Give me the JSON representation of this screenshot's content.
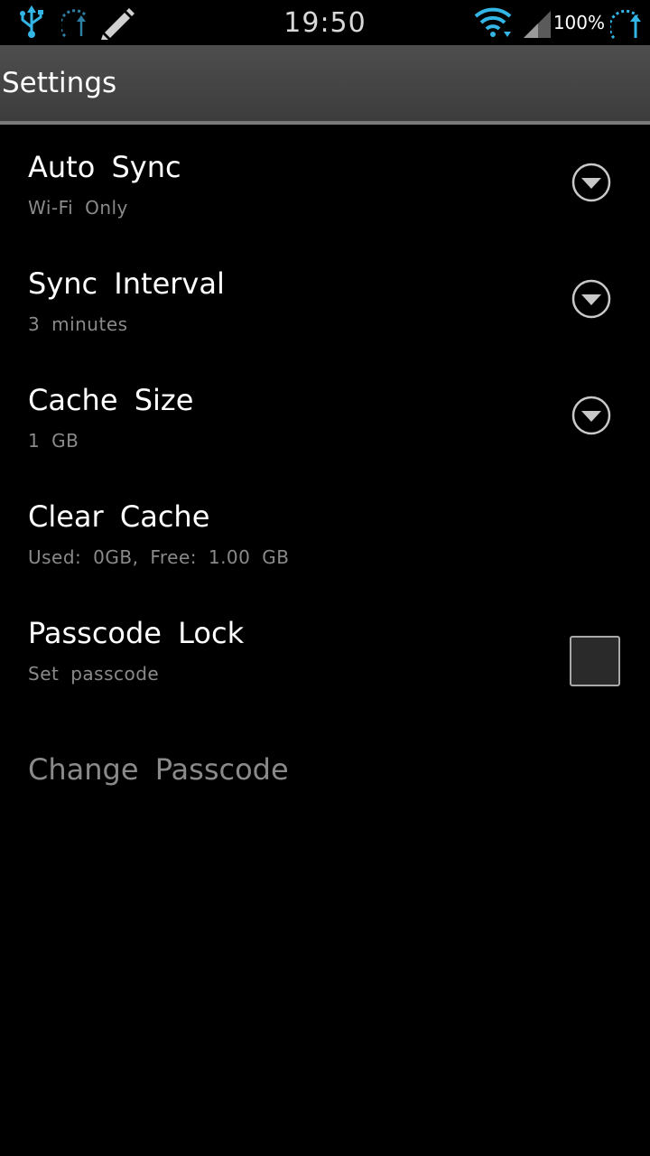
{
  "status_bar": {
    "time": "19:50",
    "battery": "100%",
    "icons": [
      "usb-icon",
      "sync-progress-icon",
      "edit-icon",
      "wifi-icon",
      "signal-icon",
      "battery-charging-icon"
    ],
    "accent": "#33b5e5"
  },
  "action_bar": {
    "title": "Settings"
  },
  "settings": [
    {
      "label": "Auto Sync",
      "summary": "Wi-Fi Only",
      "control": "dropdown"
    },
    {
      "label": "Sync Interval",
      "summary": "3 minutes",
      "control": "dropdown"
    },
    {
      "label": "Cache Size",
      "summary": "1 GB",
      "control": "dropdown"
    },
    {
      "label": "Clear Cache",
      "summary": "Used: 0GB, Free: 1.00 GB",
      "control": "none"
    },
    {
      "label": "Passcode Lock",
      "summary": "Set passcode",
      "control": "checkbox",
      "checked": false
    },
    {
      "label": "Change Passcode",
      "summary": "",
      "control": "none",
      "enabled": false
    }
  ]
}
